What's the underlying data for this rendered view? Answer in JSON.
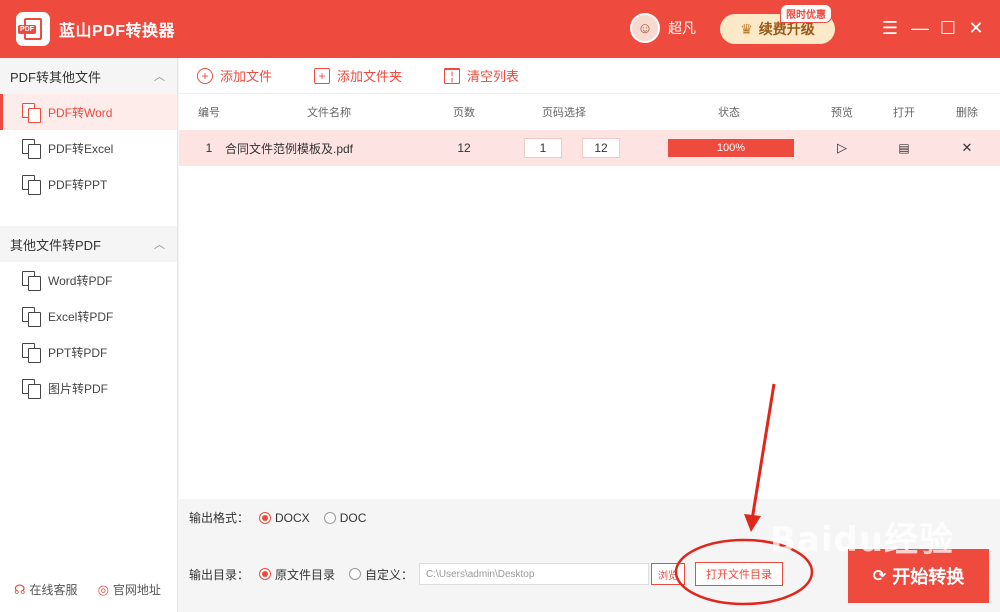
{
  "app": {
    "title": "蓝山PDF转换器",
    "logo_tag": "PDF"
  },
  "user": {
    "name": "超凡"
  },
  "upgrade": {
    "label": "续费升级",
    "badge": "限时优惠"
  },
  "window": {
    "menu": "☰",
    "minimize": "—",
    "maximize": "☐",
    "close": "✕"
  },
  "sidebar": {
    "group1": {
      "label": "PDF转其他文件",
      "items": [
        "PDF转Word",
        "PDF转Excel",
        "PDF转PPT"
      ]
    },
    "group2": {
      "label": "其他文件转PDF",
      "items": [
        "Word转PDF",
        "Excel转PDF",
        "PPT转PDF",
        "图片转PDF"
      ]
    },
    "footer": {
      "support": "在线客服",
      "website": "官网地址"
    }
  },
  "toolbar": {
    "add_file": "添加文件",
    "add_folder": "添加文件夹",
    "clear_list": "清空列表"
  },
  "table": {
    "headers": {
      "no": "编号",
      "name": "文件名称",
      "pages": "页数",
      "range": "页码选择",
      "status": "状态",
      "preview": "预览",
      "open": "打开",
      "delete": "删除"
    },
    "rows": [
      {
        "no": "1",
        "name": "合同文件范例模板及.pdf",
        "pages": "12",
        "from": "1",
        "to": "12",
        "progress": 100,
        "progress_text": "100%"
      }
    ]
  },
  "settings": {
    "format_label": "输出格式：",
    "formats": [
      "DOCX",
      "DOC"
    ],
    "format_selected": "DOCX",
    "dir_label": "输出目录：",
    "dir_options": [
      "原文件目录",
      "自定义："
    ],
    "dir_selected": "原文件目录",
    "path": "C:\\Users\\admin\\Desktop",
    "browse": "浏览",
    "open_dir": "打开文件目录",
    "start": "开始转换"
  },
  "watermark": "Baidu经验",
  "colors": {
    "accent": "#ee4a3e",
    "row_highlight": "#fde3e1",
    "upgrade_bg": "#fce9c7"
  }
}
